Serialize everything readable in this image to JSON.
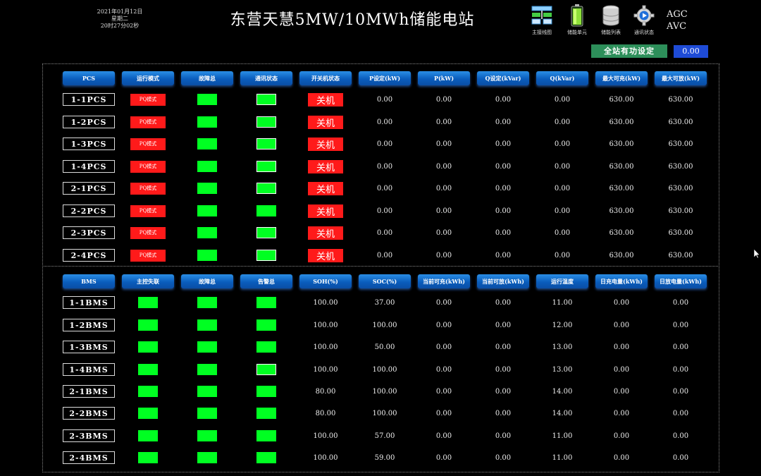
{
  "header": {
    "date": "2021年01月12日",
    "weekday": "星期二",
    "time": "20时27分02秒",
    "title": "东营天慧5MW/10MWh储能电站",
    "nav": [
      {
        "label": "主接线图",
        "icon": "network-diagram-icon"
      },
      {
        "label": "储能单元",
        "icon": "battery-icon"
      },
      {
        "label": "储能列表",
        "icon": "database-icon"
      },
      {
        "label": "通讯状态",
        "icon": "gear-play-icon"
      }
    ],
    "agc": "AGC",
    "avc": "AVC",
    "setpoint_label": "全站有功设定",
    "setpoint_value": "0.00"
  },
  "colors": {
    "led_on": "#00ff22",
    "fault_red": "#ff1a1a",
    "header_blue": "#0a5dbc",
    "setpoint_green": "#2d8f5a",
    "value_blue": "#1e4bd6"
  },
  "pcs": {
    "headers": [
      "PCS",
      "运行模式",
      "故障总",
      "通讯状态",
      "开关机状态",
      "P设定(kW)",
      "P(kW)",
      "Q设定(kVar)",
      "Q(kVar)",
      "最大可充(kW)",
      "最大可放(kW)"
    ],
    "rows": [
      {
        "name": "1-1PCS",
        "mode": "PQ模式",
        "comm_framed": true,
        "onoff": "关机",
        "p_set": "0.00",
        "p": "0.00",
        "q_set": "0.00",
        "q": "0.00",
        "max_charge": "630.00",
        "max_discharge": "630.00"
      },
      {
        "name": "1-2PCS",
        "mode": "PQ模式",
        "comm_framed": true,
        "onoff": "关机",
        "p_set": "0.00",
        "p": "0.00",
        "q_set": "0.00",
        "q": "0.00",
        "max_charge": "630.00",
        "max_discharge": "630.00"
      },
      {
        "name": "1-3PCS",
        "mode": "PQ模式",
        "comm_framed": true,
        "onoff": "关机",
        "p_set": "0.00",
        "p": "0.00",
        "q_set": "0.00",
        "q": "0.00",
        "max_charge": "630.00",
        "max_discharge": "630.00"
      },
      {
        "name": "1-4PCS",
        "mode": "PQ模式",
        "comm_framed": true,
        "onoff": "关机",
        "p_set": "0.00",
        "p": "0.00",
        "q_set": "0.00",
        "q": "0.00",
        "max_charge": "630.00",
        "max_discharge": "630.00"
      },
      {
        "name": "2-1PCS",
        "mode": "PQ模式",
        "comm_framed": true,
        "onoff": "关机",
        "p_set": "0.00",
        "p": "0.00",
        "q_set": "0.00",
        "q": "0.00",
        "max_charge": "630.00",
        "max_discharge": "630.00"
      },
      {
        "name": "2-2PCS",
        "mode": "PQ模式",
        "comm_framed": false,
        "onoff": "关机",
        "p_set": "0.00",
        "p": "0.00",
        "q_set": "0.00",
        "q": "0.00",
        "max_charge": "630.00",
        "max_discharge": "630.00"
      },
      {
        "name": "2-3PCS",
        "mode": "PQ模式",
        "comm_framed": true,
        "onoff": "关机",
        "p_set": "0.00",
        "p": "0.00",
        "q_set": "0.00",
        "q": "0.00",
        "max_charge": "630.00",
        "max_discharge": "630.00"
      },
      {
        "name": "2-4PCS",
        "mode": "PQ模式",
        "comm_framed": true,
        "onoff": "关机",
        "p_set": "0.00",
        "p": "0.00",
        "q_set": "0.00",
        "q": "0.00",
        "max_charge": "630.00",
        "max_discharge": "630.00"
      }
    ]
  },
  "bms": {
    "headers": [
      "BMS",
      "主控失联",
      "故障总",
      "告警总",
      "SOH(%)",
      "SOC(%)",
      "当前可充(kWh)",
      "当前可放(kWh)",
      "运行温度",
      "日充电量(kWh)",
      "日放电量(kWh)"
    ],
    "rows": [
      {
        "name": "1-1BMS",
        "alarm_framed": false,
        "soh": "100.00",
        "soc": "37.00",
        "chargeable": "0.00",
        "dischargeable": "0.00",
        "temp": "11.00",
        "day_charge": "0.00",
        "day_discharge": "0.00"
      },
      {
        "name": "1-2BMS",
        "alarm_framed": false,
        "soh": "100.00",
        "soc": "100.00",
        "chargeable": "0.00",
        "dischargeable": "0.00",
        "temp": "12.00",
        "day_charge": "0.00",
        "day_discharge": "0.00"
      },
      {
        "name": "1-3BMS",
        "alarm_framed": false,
        "soh": "100.00",
        "soc": "50.00",
        "chargeable": "0.00",
        "dischargeable": "0.00",
        "temp": "13.00",
        "day_charge": "0.00",
        "day_discharge": "0.00"
      },
      {
        "name": "1-4BMS",
        "alarm_framed": true,
        "soh": "100.00",
        "soc": "100.00",
        "chargeable": "0.00",
        "dischargeable": "0.00",
        "temp": "13.00",
        "day_charge": "0.00",
        "day_discharge": "0.00"
      },
      {
        "name": "2-1BMS",
        "alarm_framed": false,
        "soh": "80.00",
        "soc": "100.00",
        "chargeable": "0.00",
        "dischargeable": "0.00",
        "temp": "14.00",
        "day_charge": "0.00",
        "day_discharge": "0.00"
      },
      {
        "name": "2-2BMS",
        "alarm_framed": false,
        "soh": "80.00",
        "soc": "100.00",
        "chargeable": "0.00",
        "dischargeable": "0.00",
        "temp": "14.00",
        "day_charge": "0.00",
        "day_discharge": "0.00"
      },
      {
        "name": "2-3BMS",
        "alarm_framed": false,
        "soh": "100.00",
        "soc": "57.00",
        "chargeable": "0.00",
        "dischargeable": "0.00",
        "temp": "11.00",
        "day_charge": "0.00",
        "day_discharge": "0.00"
      },
      {
        "name": "2-4BMS",
        "alarm_framed": false,
        "soh": "100.00",
        "soc": "59.00",
        "chargeable": "0.00",
        "dischargeable": "0.00",
        "temp": "11.00",
        "day_charge": "0.00",
        "day_discharge": "0.00"
      }
    ]
  }
}
